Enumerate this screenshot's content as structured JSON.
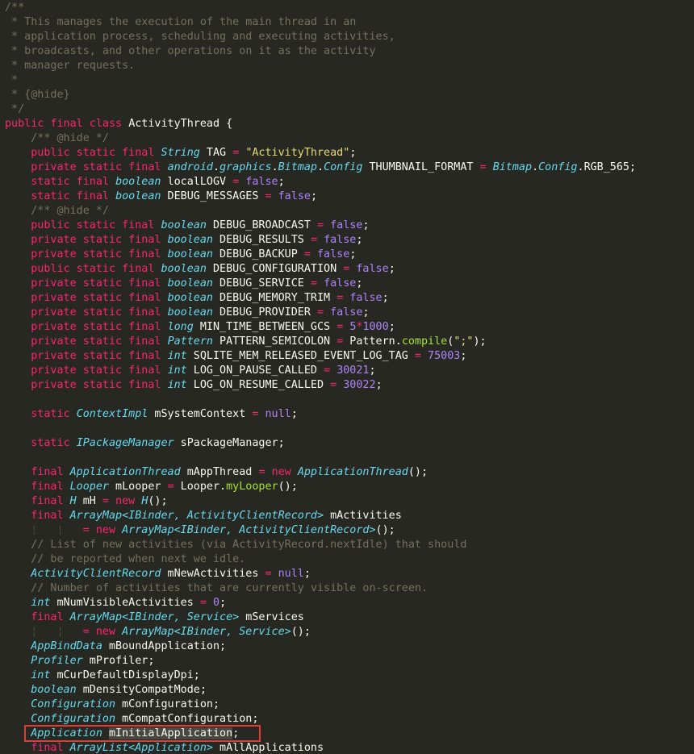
{
  "editor": {
    "language": "java",
    "theme_colors": {
      "background": "#272822",
      "comment": "#75715e",
      "keyword": "#f92672",
      "type": "#66d9ef",
      "number": "#ae81ff",
      "string": "#e6db74",
      "function": "#a6e22e",
      "identifier": "#f8f8f2",
      "highlight_box": "#e53935"
    },
    "highlighted_line_index": 50,
    "lines": [
      [
        [
          "cm",
          "/**"
        ]
      ],
      [
        [
          "cm",
          " * This manages the execution of the main thread in an"
        ]
      ],
      [
        [
          "cm",
          " * application process, scheduling and executing activities,"
        ]
      ],
      [
        [
          "cm",
          " * broadcasts, and other operations on it as the activity"
        ]
      ],
      [
        [
          "cm",
          " * manager requests."
        ]
      ],
      [
        [
          "cm",
          " *"
        ]
      ],
      [
        [
          "cm",
          " * {@hide}"
        ]
      ],
      [
        [
          "cm",
          " */"
        ]
      ],
      [
        [
          "kw",
          "public final class "
        ],
        [
          "id",
          "ActivityThread "
        ],
        [
          "pu",
          "{"
        ]
      ],
      [
        [
          "pu",
          "    "
        ],
        [
          "cm",
          "/** @hide */"
        ]
      ],
      [
        [
          "pu",
          "    "
        ],
        [
          "kw",
          "public static final "
        ],
        [
          "ty",
          "String"
        ],
        [
          "id",
          " TAG "
        ],
        [
          "kw",
          "="
        ],
        [
          "id",
          " "
        ],
        [
          "st",
          "\"ActivityThread\""
        ],
        [
          "pu",
          ";"
        ]
      ],
      [
        [
          "pu",
          "    "
        ],
        [
          "kw",
          "private static final "
        ],
        [
          "ty",
          "android"
        ],
        [
          "pu",
          "."
        ],
        [
          "ty",
          "graphics"
        ],
        [
          "pu",
          "."
        ],
        [
          "ty",
          "Bitmap"
        ],
        [
          "pu",
          "."
        ],
        [
          "ty",
          "Config"
        ],
        [
          "id",
          " THUMBNAIL_FORMAT "
        ],
        [
          "kw",
          "="
        ],
        [
          "id",
          " "
        ],
        [
          "ty",
          "Bitmap"
        ],
        [
          "pu",
          "."
        ],
        [
          "ty",
          "Config"
        ],
        [
          "pu",
          "."
        ],
        [
          "id",
          "RGB_565"
        ],
        [
          "pu",
          ";"
        ]
      ],
      [
        [
          "pu",
          "    "
        ],
        [
          "kw",
          "static final "
        ],
        [
          "ty",
          "boolean"
        ],
        [
          "id",
          " localLOGV "
        ],
        [
          "kw",
          "="
        ],
        [
          "id",
          " "
        ],
        [
          "nb",
          "false"
        ],
        [
          "pu",
          ";"
        ]
      ],
      [
        [
          "pu",
          "    "
        ],
        [
          "kw",
          "static final "
        ],
        [
          "ty",
          "boolean"
        ],
        [
          "id",
          " DEBUG_MESSAGES "
        ],
        [
          "kw",
          "="
        ],
        [
          "id",
          " "
        ],
        [
          "nb",
          "false"
        ],
        [
          "pu",
          ";"
        ]
      ],
      [
        [
          "pu",
          "    "
        ],
        [
          "cm",
          "/** @hide */"
        ]
      ],
      [
        [
          "pu",
          "    "
        ],
        [
          "kw",
          "public static final "
        ],
        [
          "ty",
          "boolean"
        ],
        [
          "id",
          " DEBUG_BROADCAST "
        ],
        [
          "kw",
          "="
        ],
        [
          "id",
          " "
        ],
        [
          "nb",
          "false"
        ],
        [
          "pu",
          ";"
        ]
      ],
      [
        [
          "pu",
          "    "
        ],
        [
          "kw",
          "private static final "
        ],
        [
          "ty",
          "boolean"
        ],
        [
          "id",
          " DEBUG_RESULTS "
        ],
        [
          "kw",
          "="
        ],
        [
          "id",
          " "
        ],
        [
          "nb",
          "false"
        ],
        [
          "pu",
          ";"
        ]
      ],
      [
        [
          "pu",
          "    "
        ],
        [
          "kw",
          "private static final "
        ],
        [
          "ty",
          "boolean"
        ],
        [
          "id",
          " DEBUG_BACKUP "
        ],
        [
          "kw",
          "="
        ],
        [
          "id",
          " "
        ],
        [
          "nb",
          "false"
        ],
        [
          "pu",
          ";"
        ]
      ],
      [
        [
          "pu",
          "    "
        ],
        [
          "kw",
          "public static final "
        ],
        [
          "ty",
          "boolean"
        ],
        [
          "id",
          " DEBUG_CONFIGURATION "
        ],
        [
          "kw",
          "="
        ],
        [
          "id",
          " "
        ],
        [
          "nb",
          "false"
        ],
        [
          "pu",
          ";"
        ]
      ],
      [
        [
          "pu",
          "    "
        ],
        [
          "kw",
          "private static final "
        ],
        [
          "ty",
          "boolean"
        ],
        [
          "id",
          " DEBUG_SERVICE "
        ],
        [
          "kw",
          "="
        ],
        [
          "id",
          " "
        ],
        [
          "nb",
          "false"
        ],
        [
          "pu",
          ";"
        ]
      ],
      [
        [
          "pu",
          "    "
        ],
        [
          "kw",
          "private static final "
        ],
        [
          "ty",
          "boolean"
        ],
        [
          "id",
          " DEBUG_MEMORY_TRIM "
        ],
        [
          "kw",
          "="
        ],
        [
          "id",
          " "
        ],
        [
          "nb",
          "false"
        ],
        [
          "pu",
          ";"
        ]
      ],
      [
        [
          "pu",
          "    "
        ],
        [
          "kw",
          "private static final "
        ],
        [
          "ty",
          "boolean"
        ],
        [
          "id",
          " DEBUG_PROVIDER "
        ],
        [
          "kw",
          "="
        ],
        [
          "id",
          " "
        ],
        [
          "nb",
          "false"
        ],
        [
          "pu",
          ";"
        ]
      ],
      [
        [
          "pu",
          "    "
        ],
        [
          "kw",
          "private static final "
        ],
        [
          "ty",
          "long"
        ],
        [
          "id",
          " MIN_TIME_BETWEEN_GCS "
        ],
        [
          "kw",
          "="
        ],
        [
          "id",
          " "
        ],
        [
          "nb",
          "5"
        ],
        [
          "kw",
          "*"
        ],
        [
          "nb",
          "1000"
        ],
        [
          "pu",
          ";"
        ]
      ],
      [
        [
          "pu",
          "    "
        ],
        [
          "kw",
          "private static final "
        ],
        [
          "ty",
          "Pattern"
        ],
        [
          "id",
          " PATTERN_SEMICOLON "
        ],
        [
          "kw",
          "="
        ],
        [
          "id",
          " Pattern."
        ],
        [
          "fn",
          "compile"
        ],
        [
          "pu",
          "("
        ],
        [
          "st",
          "\";\""
        ],
        [
          "pu",
          ");"
        ]
      ],
      [
        [
          "pu",
          "    "
        ],
        [
          "kw",
          "private static final "
        ],
        [
          "ty",
          "int"
        ],
        [
          "id",
          " SQLITE_MEM_RELEASED_EVENT_LOG_TAG "
        ],
        [
          "kw",
          "="
        ],
        [
          "id",
          " "
        ],
        [
          "nb",
          "75003"
        ],
        [
          "pu",
          ";"
        ]
      ],
      [
        [
          "pu",
          "    "
        ],
        [
          "kw",
          "private static final "
        ],
        [
          "ty",
          "int"
        ],
        [
          "id",
          " LOG_ON_PAUSE_CALLED "
        ],
        [
          "kw",
          "="
        ],
        [
          "id",
          " "
        ],
        [
          "nb",
          "30021"
        ],
        [
          "pu",
          ";"
        ]
      ],
      [
        [
          "pu",
          "    "
        ],
        [
          "kw",
          "private static final "
        ],
        [
          "ty",
          "int"
        ],
        [
          "id",
          " LOG_ON_RESUME_CALLED "
        ],
        [
          "kw",
          "="
        ],
        [
          "id",
          " "
        ],
        [
          "nb",
          "30022"
        ],
        [
          "pu",
          ";"
        ]
      ],
      [],
      [
        [
          "pu",
          "    "
        ],
        [
          "kw",
          "static "
        ],
        [
          "ty",
          "ContextImpl"
        ],
        [
          "id",
          " mSystemContext "
        ],
        [
          "kw",
          "="
        ],
        [
          "id",
          " "
        ],
        [
          "nb",
          "null"
        ],
        [
          "pu",
          ";"
        ]
      ],
      [],
      [
        [
          "pu",
          "    "
        ],
        [
          "kw",
          "static "
        ],
        [
          "ty",
          "IPackageManager"
        ],
        [
          "id",
          " sPackageManager;"
        ]
      ],
      [],
      [
        [
          "pu",
          "    "
        ],
        [
          "kw",
          "final "
        ],
        [
          "ty",
          "ApplicationThread"
        ],
        [
          "id",
          " mAppThread "
        ],
        [
          "kw",
          "="
        ],
        [
          "id",
          " "
        ],
        [
          "kw",
          "new "
        ],
        [
          "ty",
          "ApplicationThread"
        ],
        [
          "pu",
          "();"
        ]
      ],
      [
        [
          "pu",
          "    "
        ],
        [
          "kw",
          "final "
        ],
        [
          "ty",
          "Looper"
        ],
        [
          "id",
          " mLooper "
        ],
        [
          "kw",
          "="
        ],
        [
          "id",
          " Looper."
        ],
        [
          "fn",
          "myLooper"
        ],
        [
          "pu",
          "();"
        ]
      ],
      [
        [
          "pu",
          "    "
        ],
        [
          "kw",
          "final "
        ],
        [
          "ty",
          "H"
        ],
        [
          "id",
          " mH "
        ],
        [
          "kw",
          "="
        ],
        [
          "id",
          " "
        ],
        [
          "kw",
          "new "
        ],
        [
          "ty",
          "H"
        ],
        [
          "pu",
          "();"
        ]
      ],
      [
        [
          "pu",
          "    "
        ],
        [
          "kw",
          "final "
        ],
        [
          "ty",
          "ArrayMap<IBinder, ActivityClientRecord>"
        ],
        [
          "id",
          " mActivities"
        ]
      ],
      [
        [
          "pu",
          "    "
        ],
        [
          "gd",
          "¦"
        ],
        [
          "pu",
          "   "
        ],
        [
          "gd",
          "¦"
        ],
        [
          "pu",
          "   "
        ],
        [
          "kw",
          "= new "
        ],
        [
          "ty",
          "ArrayMap<IBinder, ActivityClientRecord>"
        ],
        [
          "pu",
          "();"
        ]
      ],
      [
        [
          "pu",
          "    "
        ],
        [
          "cm",
          "// List of new activities (via ActivityRecord.nextIdle) that should"
        ]
      ],
      [
        [
          "pu",
          "    "
        ],
        [
          "cm",
          "// be reported when next we idle."
        ]
      ],
      [
        [
          "pu",
          "    "
        ],
        [
          "ty",
          "ActivityClientRecord"
        ],
        [
          "id",
          " mNewActivities "
        ],
        [
          "kw",
          "="
        ],
        [
          "id",
          " "
        ],
        [
          "nb",
          "null"
        ],
        [
          "pu",
          ";"
        ]
      ],
      [
        [
          "pu",
          "    "
        ],
        [
          "cm",
          "// Number of activities that are currently visible on-screen."
        ]
      ],
      [
        [
          "pu",
          "    "
        ],
        [
          "ty",
          "int"
        ],
        [
          "id",
          " mNumVisibleActivities "
        ],
        [
          "kw",
          "="
        ],
        [
          "id",
          " "
        ],
        [
          "nb",
          "0"
        ],
        [
          "pu",
          ";"
        ]
      ],
      [
        [
          "pu",
          "    "
        ],
        [
          "kw",
          "final "
        ],
        [
          "ty",
          "ArrayMap<IBinder, Service>"
        ],
        [
          "id",
          " mServices"
        ]
      ],
      [
        [
          "pu",
          "    "
        ],
        [
          "gd",
          "¦"
        ],
        [
          "pu",
          "   "
        ],
        [
          "gd",
          "¦"
        ],
        [
          "pu",
          "   "
        ],
        [
          "kw",
          "= new "
        ],
        [
          "ty",
          "ArrayMap<IBinder, Service>"
        ],
        [
          "pu",
          "();"
        ]
      ],
      [
        [
          "pu",
          "    "
        ],
        [
          "ty",
          "AppBindData"
        ],
        [
          "id",
          " mBoundApplication;"
        ]
      ],
      [
        [
          "pu",
          "    "
        ],
        [
          "ty",
          "Profiler"
        ],
        [
          "id",
          " mProfiler;"
        ]
      ],
      [
        [
          "pu",
          "    "
        ],
        [
          "ty",
          "int"
        ],
        [
          "id",
          " mCurDefaultDisplayDpi;"
        ]
      ],
      [
        [
          "pu",
          "    "
        ],
        [
          "ty",
          "boolean"
        ],
        [
          "id",
          " mDensityCompatMode;"
        ]
      ],
      [
        [
          "pu",
          "    "
        ],
        [
          "ty",
          "Configuration"
        ],
        [
          "id",
          " mConfiguration;"
        ]
      ],
      [
        [
          "pu",
          "    "
        ],
        [
          "ty",
          "Configuration"
        ],
        [
          "id",
          " mCompatConfiguration;"
        ]
      ],
      [
        [
          "pu",
          "    "
        ],
        [
          "ty",
          "Application"
        ],
        [
          "pu",
          " "
        ],
        [
          "sel",
          "mInitialApplication"
        ],
        [
          "pu",
          ";"
        ]
      ],
      [
        [
          "pu",
          "    "
        ],
        [
          "kw",
          "final "
        ],
        [
          "ty",
          "ArrayList<Application>"
        ],
        [
          "id",
          " mAllApplications"
        ]
      ]
    ]
  }
}
